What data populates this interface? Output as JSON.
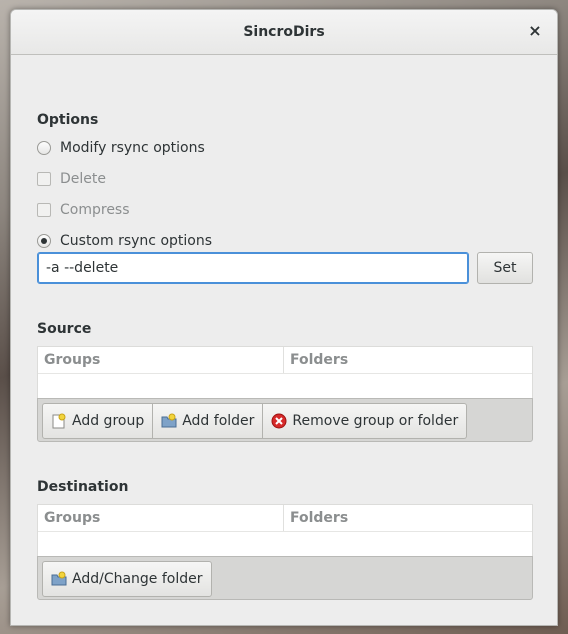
{
  "window": {
    "title": "SincroDirs",
    "close_glyph": "×"
  },
  "options": {
    "section_title": "Options",
    "modify_rsync_label": "Modify rsync options",
    "delete_label": "Delete",
    "compress_label": "Compress",
    "custom_rsync_label": "Custom rsync options",
    "custom_value": "-a --delete",
    "set_label": "Set"
  },
  "source": {
    "section_title": "Source",
    "col_groups": "Groups",
    "col_folders": "Folders",
    "add_group_label": "Add group",
    "add_folder_label": "Add folder",
    "remove_label": "Remove group or folder"
  },
  "destination": {
    "section_title": "Destination",
    "col_groups": "Groups",
    "col_folders": "Folders",
    "add_change_label": "Add/Change folder"
  },
  "state": {
    "modify_rsync_checked": false,
    "custom_rsync_checked": true,
    "delete_checked": false,
    "compress_checked": false
  }
}
